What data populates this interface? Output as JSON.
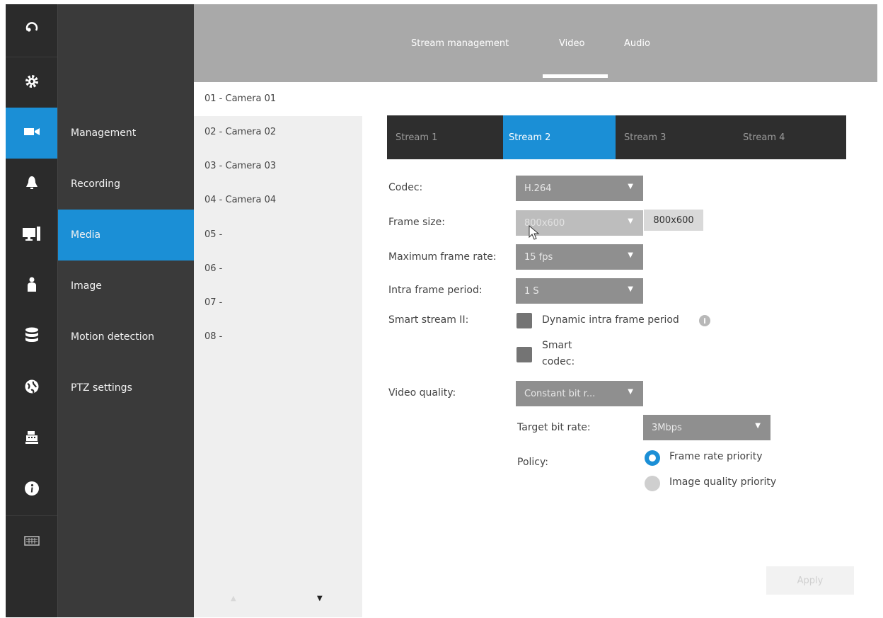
{
  "rail": {
    "icons": [
      "logout-icon",
      "gear-icon",
      "camera-icon",
      "alarm-bell-icon",
      "monitor-icon",
      "user-icon",
      "database-icon",
      "globe-icon",
      "cash-register-icon",
      "info-icon",
      "keyboard-icon"
    ],
    "active_index": 2,
    "accent": "#1b8fd6"
  },
  "menu": {
    "items": [
      {
        "label": "Management"
      },
      {
        "label": "Recording"
      },
      {
        "label": "Media"
      },
      {
        "label": "Image"
      },
      {
        "label": "Motion detection"
      },
      {
        "label": "PTZ settings"
      }
    ],
    "active_index": 2
  },
  "top_tabs": {
    "items": [
      {
        "label": "Stream management"
      },
      {
        "label": "Video"
      },
      {
        "label": "Audio"
      }
    ],
    "active_index": 1
  },
  "cameras": {
    "items": [
      "01 - Camera 01",
      "02 - Camera 02",
      "03 - Camera 03",
      "04 - Camera 04",
      "05 -",
      "06 -",
      "07 -",
      "08 -"
    ],
    "selected_index": 0
  },
  "streams": {
    "items": [
      "Stream 1",
      "Stream 2",
      "Stream 3",
      "Stream 4"
    ],
    "active_index": 1
  },
  "form": {
    "codec_label": "Codec:",
    "codec_value": "H.264",
    "frame_size_label": "Frame size:",
    "frame_size_value": "800x600",
    "frame_size_tooltip": "800x600",
    "max_frame_rate_label": "Maximum frame rate:",
    "max_frame_rate_value": "15 fps",
    "intra_frame_label": "Intra frame period:",
    "intra_frame_value": "1 S",
    "smart_stream_label": "Smart stream II:",
    "dynamic_intra_label": "Dynamic intra frame period",
    "smart_codec_label_line1": "Smart",
    "smart_codec_label_line2": "codec:",
    "video_quality_label": "Video quality:",
    "video_quality_value": "Constant bit r...",
    "target_bit_rate_label": "Target bit rate:",
    "target_bit_rate_value": "3Mbps",
    "policy_label": "Policy:",
    "policy_options": [
      "Frame rate priority",
      "Image quality priority"
    ],
    "policy_selected_index": 0
  },
  "apply_label": "Apply"
}
